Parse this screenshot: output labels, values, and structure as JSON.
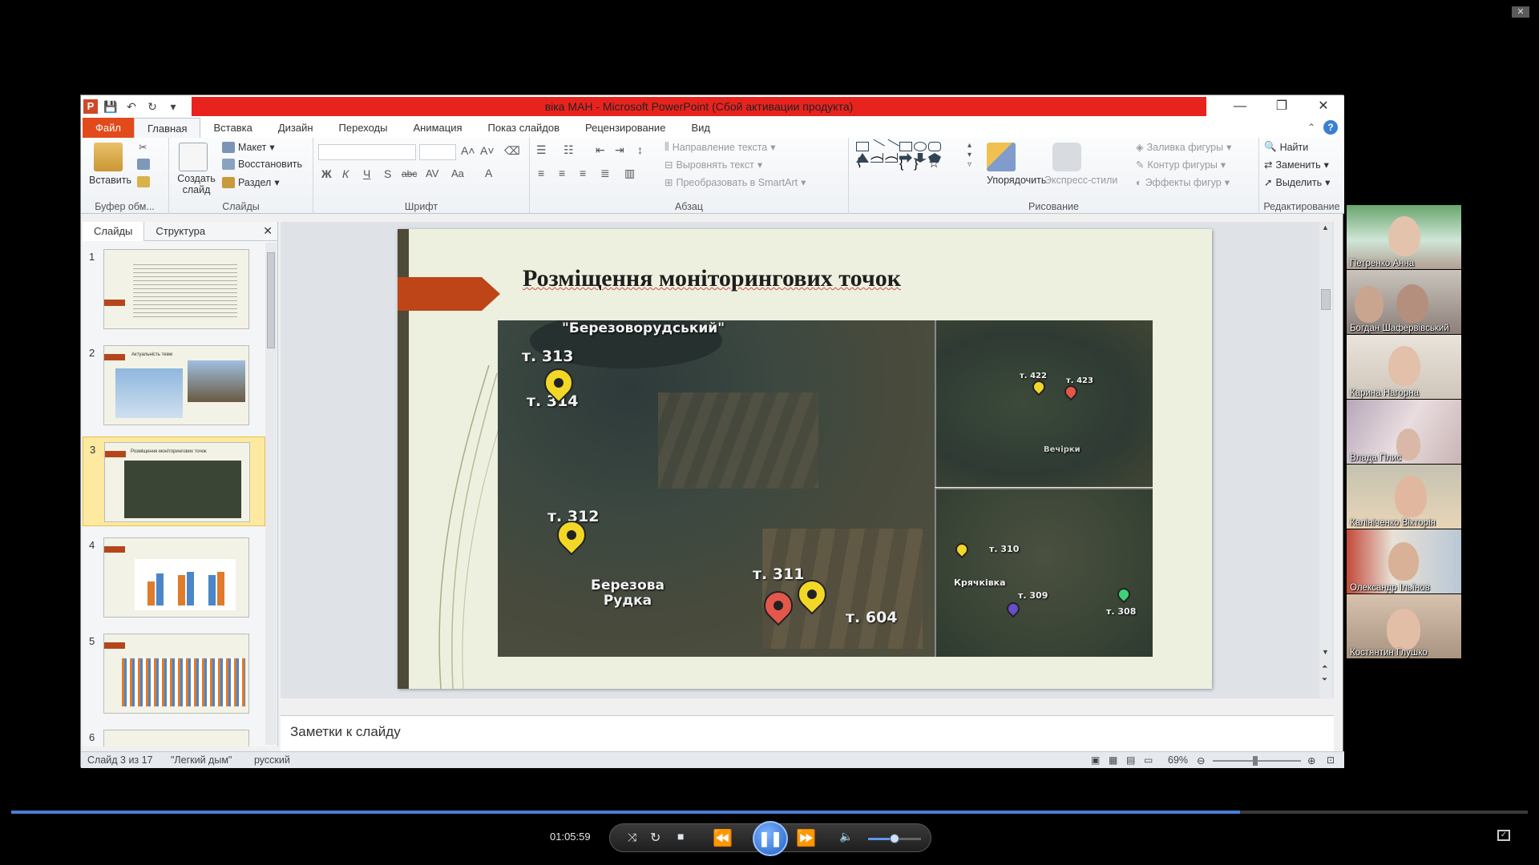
{
  "window": {
    "title": "віка МАН  -  Microsoft PowerPoint (Сбой активации продукта)",
    "app_letter": "P"
  },
  "tabs": [
    "Файл",
    "Главная",
    "Вставка",
    "Дизайн",
    "Переходы",
    "Анимация",
    "Показ слайдов",
    "Рецензирование",
    "Вид"
  ],
  "ribbon": {
    "clipboard": {
      "paste": "Вставить",
      "group": "Буфер обм..."
    },
    "slides": {
      "create": "Создать слайд",
      "layout": "Макет",
      "reset": "Восстановить",
      "section": "Раздел",
      "group": "Слайды"
    },
    "font": {
      "group": "Шрифт",
      "bold": "Ж",
      "italic": "К",
      "underline": "Ч",
      "strike": "S",
      "abc": "abc",
      "spacing": "AV",
      "case": "Aa",
      "color": "A"
    },
    "paragraph": {
      "group": "Абзац",
      "text_direction": "Направление текста",
      "align_text": "Выровнять текст",
      "smartart": "Преобразовать в SmartArt"
    },
    "drawing": {
      "group": "Рисование",
      "arrange": "Упорядочить",
      "styles": "Экспресс-стили",
      "fill": "Заливка фигуры",
      "outline": "Контур фигуры",
      "effects": "Эффекты фигур"
    },
    "editing": {
      "group": "Редактирование",
      "find": "Найти",
      "replace": "Заменить",
      "select": "Выделить"
    }
  },
  "pane": {
    "tab_slides": "Слайды",
    "tab_outline": "Структура",
    "close": "✕",
    "thumbs": [
      {
        "num": "1",
        "title": ""
      },
      {
        "num": "2",
        "title": "Актуальність теми"
      },
      {
        "num": "3",
        "title": "Розміщення моніторингових точок"
      },
      {
        "num": "4",
        "title": ""
      },
      {
        "num": "5",
        "title": ""
      },
      {
        "num": "6",
        "title": ""
      }
    ]
  },
  "slide": {
    "title": "Розміщення моніторингових точок",
    "map_labels": {
      "region": "\"Березоворудський\"",
      "t313": "т. 313",
      "t314": "т. 314",
      "t312": "т. 312",
      "t311": "т. 311",
      "t604": "т. 604",
      "village": "Березова\nРудка",
      "t422": "т. 422",
      "t423": "т. 423",
      "vechirky": "Вечірки",
      "t310": "т. 310",
      "kriachivka": "Крячківка",
      "t309": "т. 309",
      "t308": "т. 308"
    }
  },
  "notes": {
    "placeholder": "Заметки к слайду"
  },
  "status": {
    "slide_counter": "Слайд 3 из 17",
    "theme": "\"Легкий дым\"",
    "language": "русский",
    "zoom": "69%"
  },
  "participants": [
    {
      "name": "Петренко Анна"
    },
    {
      "name": "Богдан Шафервівський"
    },
    {
      "name": "Карина Нагорна"
    },
    {
      "name": "Влада Плис"
    },
    {
      "name": "Калініченко Вікторія"
    },
    {
      "name": "Олександр Ільїнов"
    },
    {
      "name": "Костянтин Глушко"
    }
  ],
  "player": {
    "time": "01:05:59",
    "progress": 0.81,
    "volume": 0.5
  },
  "colors": {
    "title_red": "#e8231e",
    "file_tab": "#e24a1c",
    "slide_accent": "#bd4518",
    "accent_blue": "#4a7fd6"
  }
}
